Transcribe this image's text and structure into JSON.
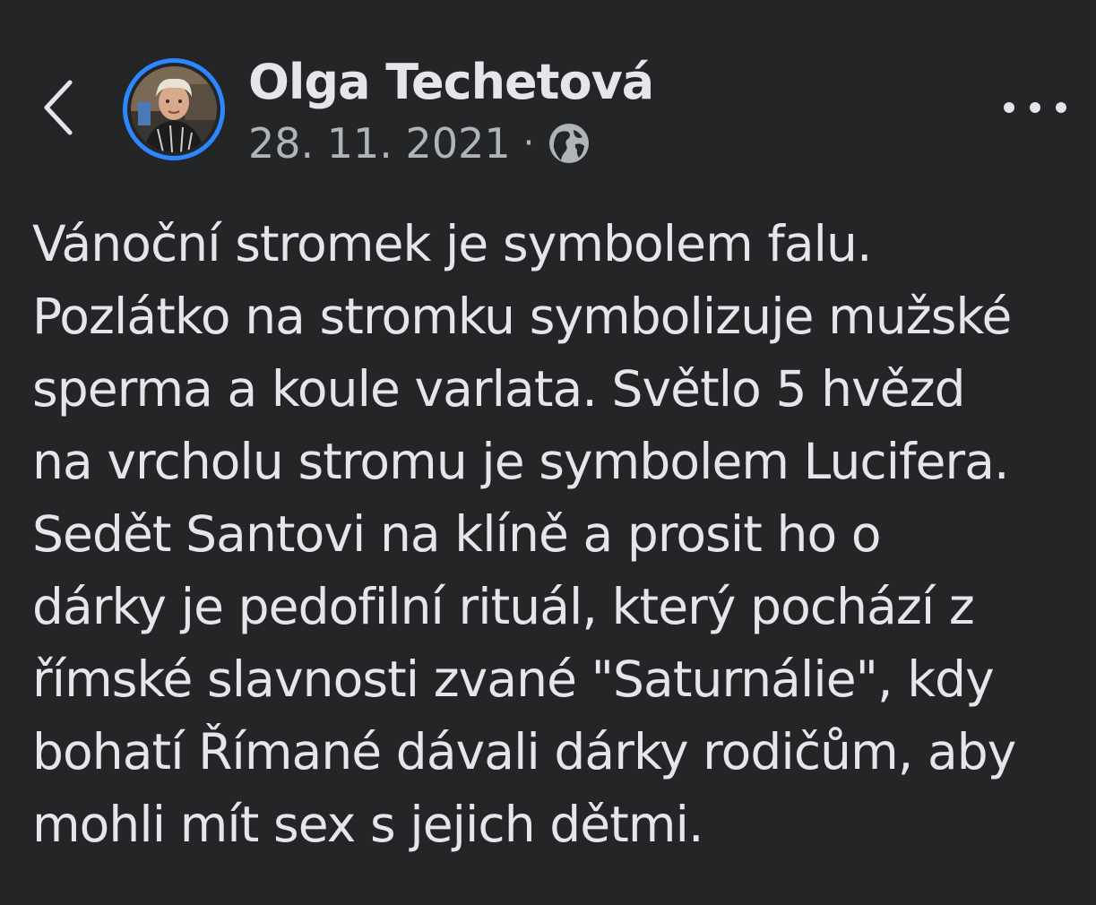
{
  "post": {
    "author": "Olga Techetová",
    "date": "28. 11. 2021",
    "separator": "·",
    "privacy_icon": "globe-icon",
    "lines": [
      "Vánoční stromek je symbolem falu.",
      "Pozlátko na stromku symbolizuje mužské",
      "sperma a koule varlata. Světlo 5 hvězd",
      "na vrcholu stromu je symbolem Lucifera.",
      "Sedět Santovi na klíně a prosit ho o",
      "dárky je pedofilní rituál, který pochází z",
      "římské slavnosti zvané \"Saturnálie\", kdy",
      "bohatí Římané dávali dárky rodičům, aby",
      "mohli mít sex s jejich dětmi."
    ]
  },
  "header": {
    "back_icon": "chevron-left-icon",
    "more_icon": "more-horizontal-icon"
  },
  "colors": {
    "background": "#242526",
    "primary_text": "#e4e6eb",
    "secondary_text": "#b0b3b8",
    "avatar_ring": "#2d88ff"
  }
}
